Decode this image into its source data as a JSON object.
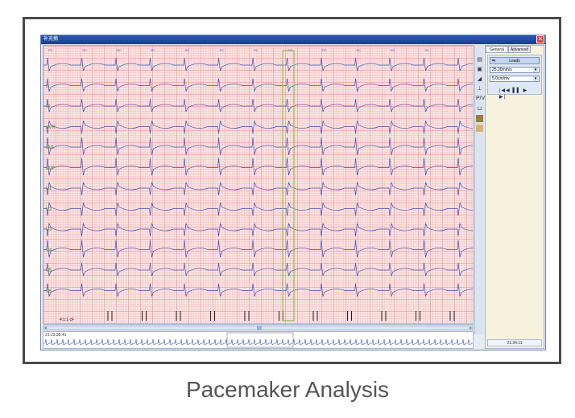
{
  "window": {
    "title": "补充摘",
    "close_glyph": "✕"
  },
  "ecg": {
    "lead_labels": [
      "",
      "II",
      "III",
      "aVR",
      "aVL",
      "aVF",
      "V1",
      "V2",
      "V3",
      "V4",
      "V5",
      "V6"
    ],
    "beat_annotation": "PC",
    "scale_label": "4:1:1 cF"
  },
  "tools": {
    "items": [
      "printer-icon",
      "print-preview-icon",
      "ruler-icon",
      "measure-icon",
      "pv-icon",
      "caliper-icon",
      "color-block-icon",
      "grid-icon"
    ],
    "pv_text": "P/V"
  },
  "panel": {
    "tabs": [
      "General",
      "Advanced"
    ],
    "leads_label": "Leads",
    "speed_value": "25.00mm/s",
    "gain_value": "5.0cm/mv",
    "play_controls": "|◀◀ ▌▌ ▶ ▶|",
    "time_readout": "21:34:11"
  },
  "overview": {
    "time_label": "21:23:38:41"
  },
  "caption": "Pacemaker Analysis"
}
